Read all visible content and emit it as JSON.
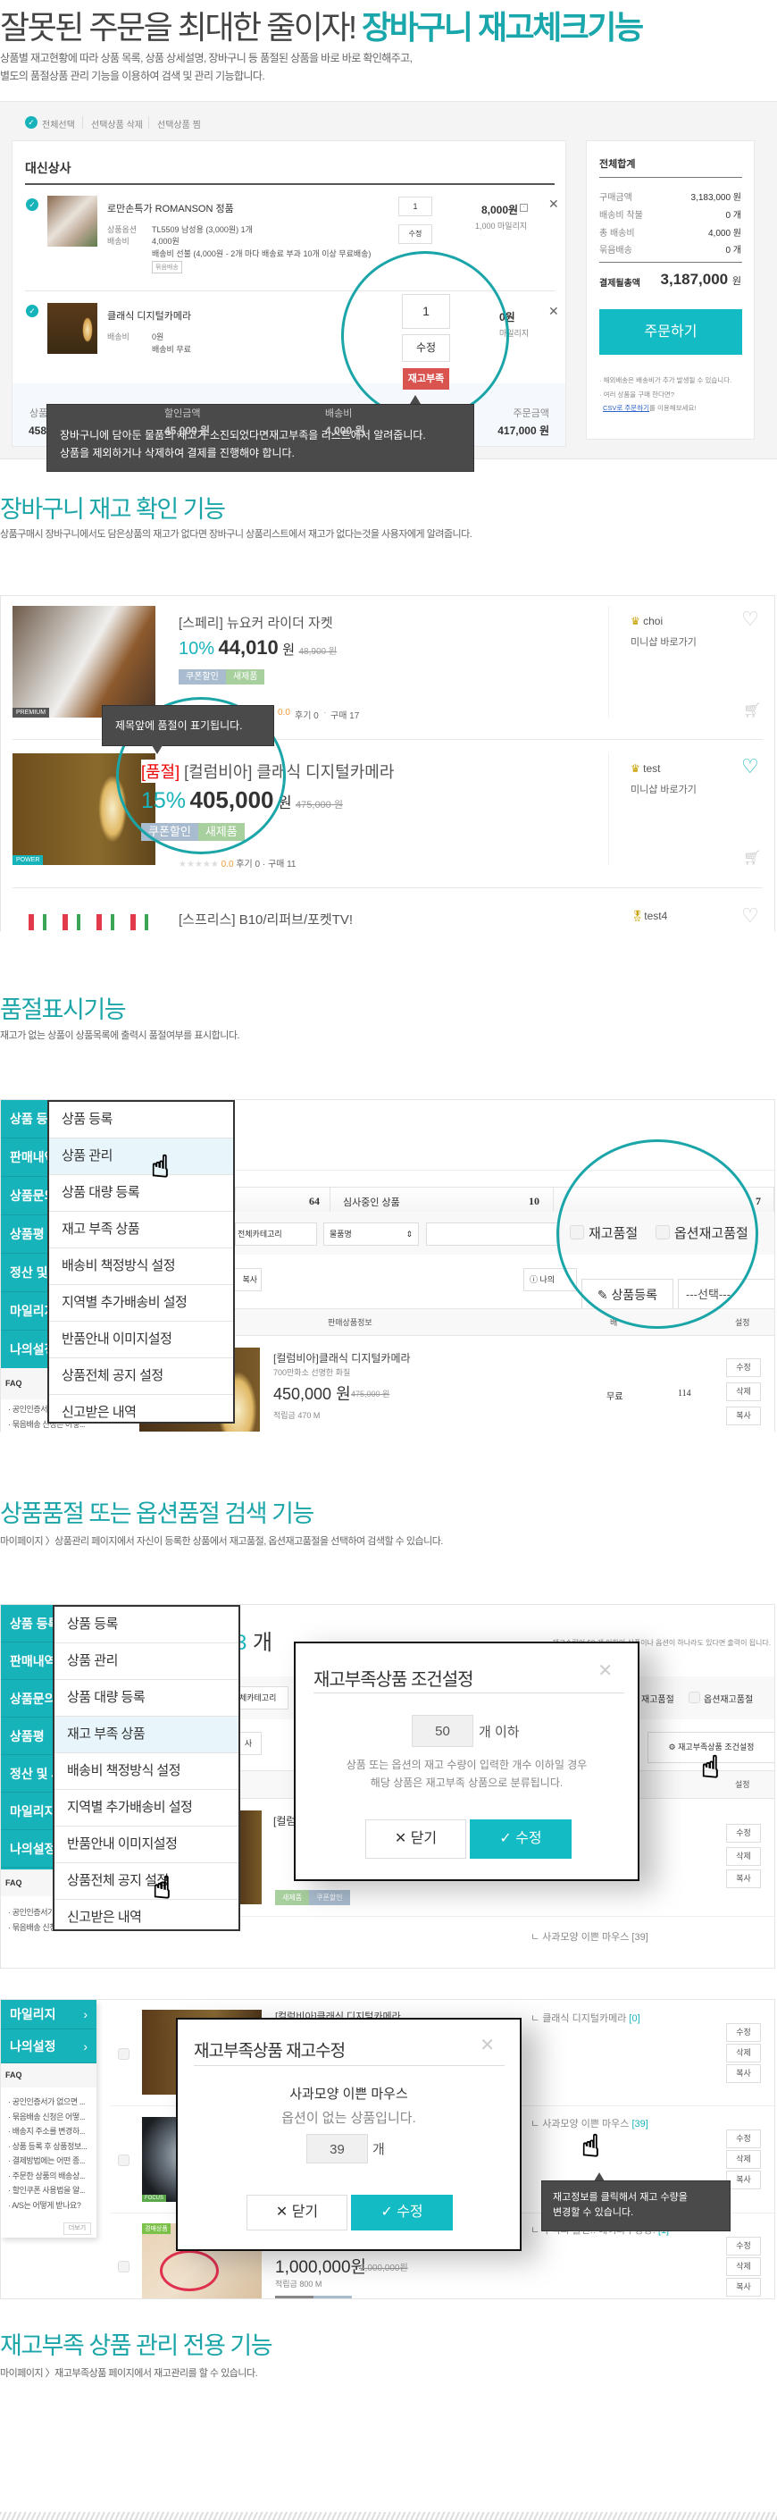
{
  "colors": {
    "teal": "#17b3ba",
    "title_teal": "#1ba5a8",
    "red": "#d9534f",
    "tooltip": "#4a4a4a"
  },
  "s1": {
    "title_a": "잘못된 주문을 최대한 줄이자!",
    "title_b": "장바구니 재고체크기능",
    "desc1": "상품별 재고현황에 따라 상품 목록, 상품 상세설명, 장바구니 등 품절된 상품을 바로 바로 확인해주고,",
    "desc2": "별도의 품절상품 관리 기능을 이용하여 검색 및 관리 기능합니다.",
    "toolbar": [
      "전체선택",
      "선택상품 삭제",
      "선택상품 찜"
    ],
    "shop": "대신상사",
    "item1": {
      "title": "로만손특가 ROMANSON 정품",
      "opt_label": "상품옵션",
      "opt": "TL5509 남성용 (3,000원) 1개",
      "ship_label": "배송비",
      "ship": "4,000원",
      "ship_note": "배송비 선불 (4,000원 - 2개 마다 배송료 부과 10개 이상 무료배송)",
      "bundle": "묶음배송",
      "qty": "1",
      "edit": "수정",
      "price": "8,000원",
      "mileage": "1,000 마일리지"
    },
    "item2": {
      "title": "클래식 디지털카메라",
      "ship_label": "배송비",
      "ship": "0원",
      "ship_note": "배송비 무료",
      "qty": "1",
      "edit": "수정",
      "stock_badge": "재고부족",
      "price": "0원",
      "mileage": "마일리지"
    },
    "footer": [
      {
        "label": "상품금액",
        "value": "458,000 원"
      },
      {
        "label": "할인금액",
        "value": "45,000 원"
      },
      {
        "label": "배송비",
        "value": "4,000 원"
      },
      {
        "label": "주문금액",
        "value": "417,000 원"
      }
    ],
    "summary": {
      "title": "전체합계",
      "rows": [
        [
          "구매금액",
          "3,183,000 원"
        ],
        [
          "배송비 착불",
          "0 개"
        ],
        [
          "총 배송비",
          "4,000 원"
        ],
        [
          "묶음배송",
          "0 개"
        ]
      ],
      "total_label": "결제될총액",
      "total": "3,187,000",
      "total_unit": "원",
      "order": "주문하기",
      "note1": "· 해외배송은 배송비가 추가 발생될 수 있습니다.",
      "note2": "· 여러 상품을 구매 한다면?",
      "csv_link": "CSV로 주문하기",
      "csv_suffix": "를 이용해보세요!"
    },
    "tooltip": [
      "장바구니에 담아둔 물품의 재고가 소진되었다면재고부족을 리스트에서 알려줍니다.",
      "상품을 제외하거나 삭제하여 결제를 진행해야 합니다."
    ]
  },
  "s2": {
    "title": "장바구니 재고 확인 기능",
    "desc": "상품구매시 장바구니에서도 담은상품의 재고가 없다면 장바구니 상품리스트에서 재고가 없다는것을 사용자에게 알려줍니다.",
    "products": [
      {
        "tag": "PREMIUM",
        "title": "[스페리] 뉴요커 라이더 자켓",
        "discount": "10%",
        "price": "44,010",
        "unit": "원",
        "old": "48,900 원",
        "badges": [
          "쿠폰할인",
          "새제품"
        ],
        "stars": "★★★★★",
        "rating": "0.0",
        "reviews": "후기 0",
        "sales": "구매 17",
        "seller": "choi",
        "minishop": "미니샵 바로가기"
      },
      {
        "tag": "POWER",
        "soldout": "[품절]",
        "title": "[컬럼비아] 클래식 디지털카메라",
        "discount": "15%",
        "price": "405,000",
        "unit": "원",
        "old": "475,000 원",
        "badges": [
          "쿠폰할인",
          "새제품"
        ],
        "stars": "★★★★★",
        "rating": "0.0",
        "reviews": "후기 0",
        "sales": "구매 11",
        "seller": "test",
        "minishop": "미니샵 바로가기"
      },
      {
        "title": "[스프리스] B10/리퍼브/포켓TV!",
        "seller": "test4"
      }
    ],
    "tooltip": "제목앞에 품절이 표기됩니다."
  },
  "s3": {
    "title": "품절표시기능",
    "desc": "재고가 없는 상품이 상품목록에 출력시 품절여부를 표시합니다.",
    "sidebar": [
      "상품 등록",
      "판매내역",
      "상품문의",
      "상품평",
      "정산 및 세금",
      "마일리지",
      "나의설정"
    ],
    "faq_title": "FAQ",
    "faq": [
      "· 공인인증서가 없으면 ...",
      "· 묶음배송 신청은 어떻..."
    ],
    "menu": [
      "상품 등록",
      "상품 관리",
      "상품 대량 등록",
      "재고 부족 상품",
      "배송비 책정방식 설정",
      "지역별 추가배송비 설정",
      "반품안내 이미지설정",
      "상품전체 공지 설정",
      "신고받은 내역"
    ],
    "stats": {
      "v1": "64",
      "label2": "심사중인 상품",
      "v2": "10",
      "v3": "7"
    },
    "filters": {
      "category": "전체카테고리",
      "field": "물품명"
    },
    "checks": [
      "재고품절",
      "옵션재고품절"
    ],
    "buttons": {
      "copy": "복사",
      "info": "나의",
      "register": "상품등록",
      "select": "---선택---"
    },
    "headers": {
      "info": "판매상품정보",
      "shipping": "배",
      "settings": "설정"
    },
    "product": {
      "title": "[컬럼비아]클래식 디지털카메라",
      "sub": "700만화소 선명한 화질",
      "price": "450,000 원",
      "old": "475,000 원",
      "mileage": "적립금 470 M",
      "shipping": "무료",
      "count": "114",
      "actions": [
        "수정",
        "삭제",
        "복사"
      ]
    }
  },
  "s4": {
    "title": "상품품절 또는 옵션품절 검색 기능",
    "desc": "마이페이지 〉상품관리 페이지에서 자신이 등록한 상품에서 재고품절, 옵션재고품절을 선택하여 검색할 수 있습니다.",
    "count_num": "3",
    "count_unit": "개",
    "note": "재고수량이 50 개 이하인 상품이나 옵션이 하나라도 있다면 출력이 됩니다.",
    "category": "체카테고리",
    "copy": "사",
    "checks": [
      "재고품절",
      "옵션재고품절"
    ],
    "cond_button": "재고부족상품 조건설정",
    "settings": "설정",
    "product_title": "[컬럼",
    "badges": [
      "새제품",
      "쿠폰할인"
    ],
    "actions": [
      "수정",
      "삭제",
      "복사"
    ],
    "next_option": "ㄴ 사과모양 이쁜 마우스 [39]",
    "modal": {
      "title": "재고부족상품 조건설정",
      "value": "50",
      "unit": "개 이하",
      "desc1": "상품 또는 옵션의 재고 수량이 입력한 개수 이하일 경우",
      "desc2": "해당 상품은 재고부족 상품으로 분류됩니다.",
      "close": "닫기",
      "save": "수정"
    }
  },
  "s5": {
    "sidebar": [
      "마일리지",
      "나의설정"
    ],
    "faq_title": "FAQ",
    "faq": [
      "· 공인인증서가 없으면 ...",
      "· 묶음배송 신청은 어떻...",
      "· 배송지 주소를 변경하...",
      "· 상품 등록 후 상품정보...",
      "· 결제방법에는 어떤 종...",
      "· 주문한 상품의 배송상...",
      "· 할인쿠폰 사용법을 알...",
      "· A/S는 어떻게 받나요?"
    ],
    "more": "더보기",
    "rows": [
      {
        "title": "[컬럼비아]클래식 디지털카메라",
        "option": "클래식 디지털카메라",
        "stock": "[0]"
      },
      {
        "tag": "FOCUS",
        "option": "사과모양 이쁜 마우스",
        "stock": "[39]"
      },
      {
        "tag": "경매상품",
        "option": "추억의 물건!! 베이파우팡팡!",
        "stock": "[1]",
        "price": "1,000,000원",
        "old": "2,000,000원",
        "mileage": "적립금 800 M"
      }
    ],
    "actions": [
      "수정",
      "삭제",
      "복사"
    ],
    "modal": {
      "title": "재고부족상품 재고수정",
      "product": "사과모양 이쁜 마우스",
      "no_option": "옵션이 없는 상품입니다.",
      "value": "39",
      "unit": "개",
      "close": "닫기",
      "save": "수정"
    },
    "tooltip": [
      "재고정보를 클릭해서 재고 수량을",
      "변경할 수 있습니다."
    ]
  },
  "s6": {
    "title": "재고부족 상품 관리 전용 기능",
    "desc": "마이페이지 〉재고부족상품 페이지에서 재고관리를 할 수 있습니다."
  }
}
